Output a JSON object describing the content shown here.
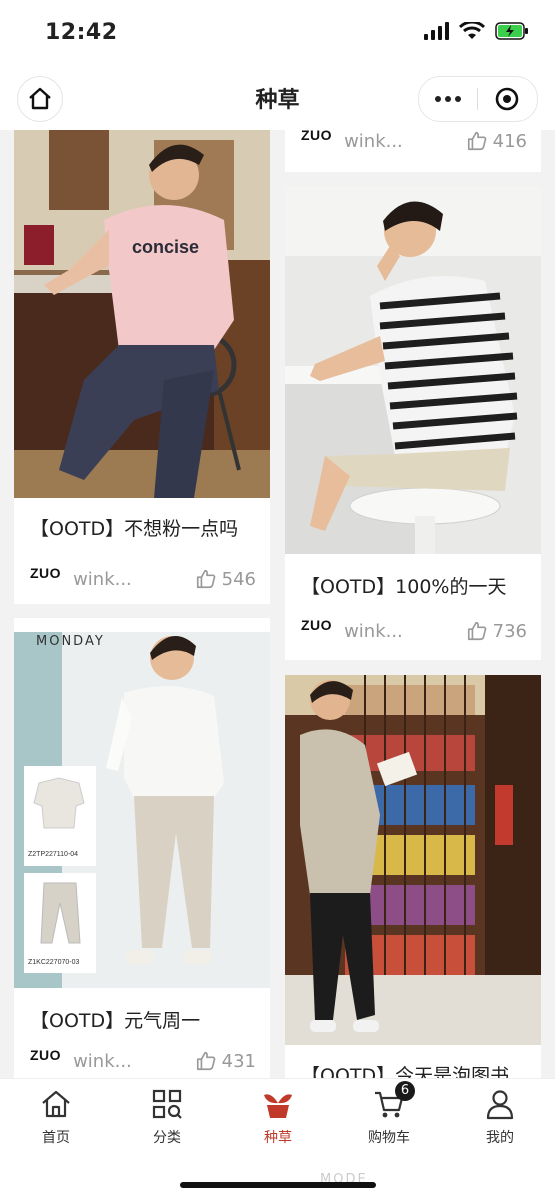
{
  "status": {
    "time": "12:42"
  },
  "nav": {
    "title": "种草"
  },
  "colors": {
    "accent": "#c0392b",
    "background": "#f2f2f2"
  },
  "feed": {
    "left": [
      {
        "title": "【OOTD】不想粉一点吗",
        "brand": "ZUO",
        "author": "wink...",
        "likes": "546",
        "image": "man in pink 'concise' tee sitting on stool in cafe",
        "shirt_text": "concise"
      },
      {
        "title": "【OOTD】元气周一",
        "brand": "ZUO",
        "author": "wink...",
        "likes": "431",
        "image": "man in white polo and beige trousers with product thumbnails",
        "header_text": "MONDAY",
        "sku_top": "Z2TP227110-04",
        "sku_bottom": "Z1KC227070-03"
      }
    ],
    "right": [
      {
        "brand": "ZUO",
        "author": "wink...",
        "likes": "416"
      },
      {
        "title": "【OOTD】100%的一天",
        "brand": "ZUO",
        "author": "wink...",
        "likes": "736",
        "image": "man in black-white striped tee sitting on white stool"
      },
      {
        "title": "【OOTD】今天是泡图书",
        "image": "man in patterned shirt reading book beside bookshelves"
      }
    ]
  },
  "tabbar": {
    "items": [
      {
        "label": "首页",
        "icon": "home-icon"
      },
      {
        "label": "分类",
        "icon": "category-icon"
      },
      {
        "label": "种草",
        "icon": "sprout-icon",
        "active": true
      },
      {
        "label": "购物车",
        "icon": "cart-icon",
        "badge": "6"
      },
      {
        "label": "我的",
        "icon": "user-icon"
      }
    ]
  },
  "watermark": "MODE"
}
